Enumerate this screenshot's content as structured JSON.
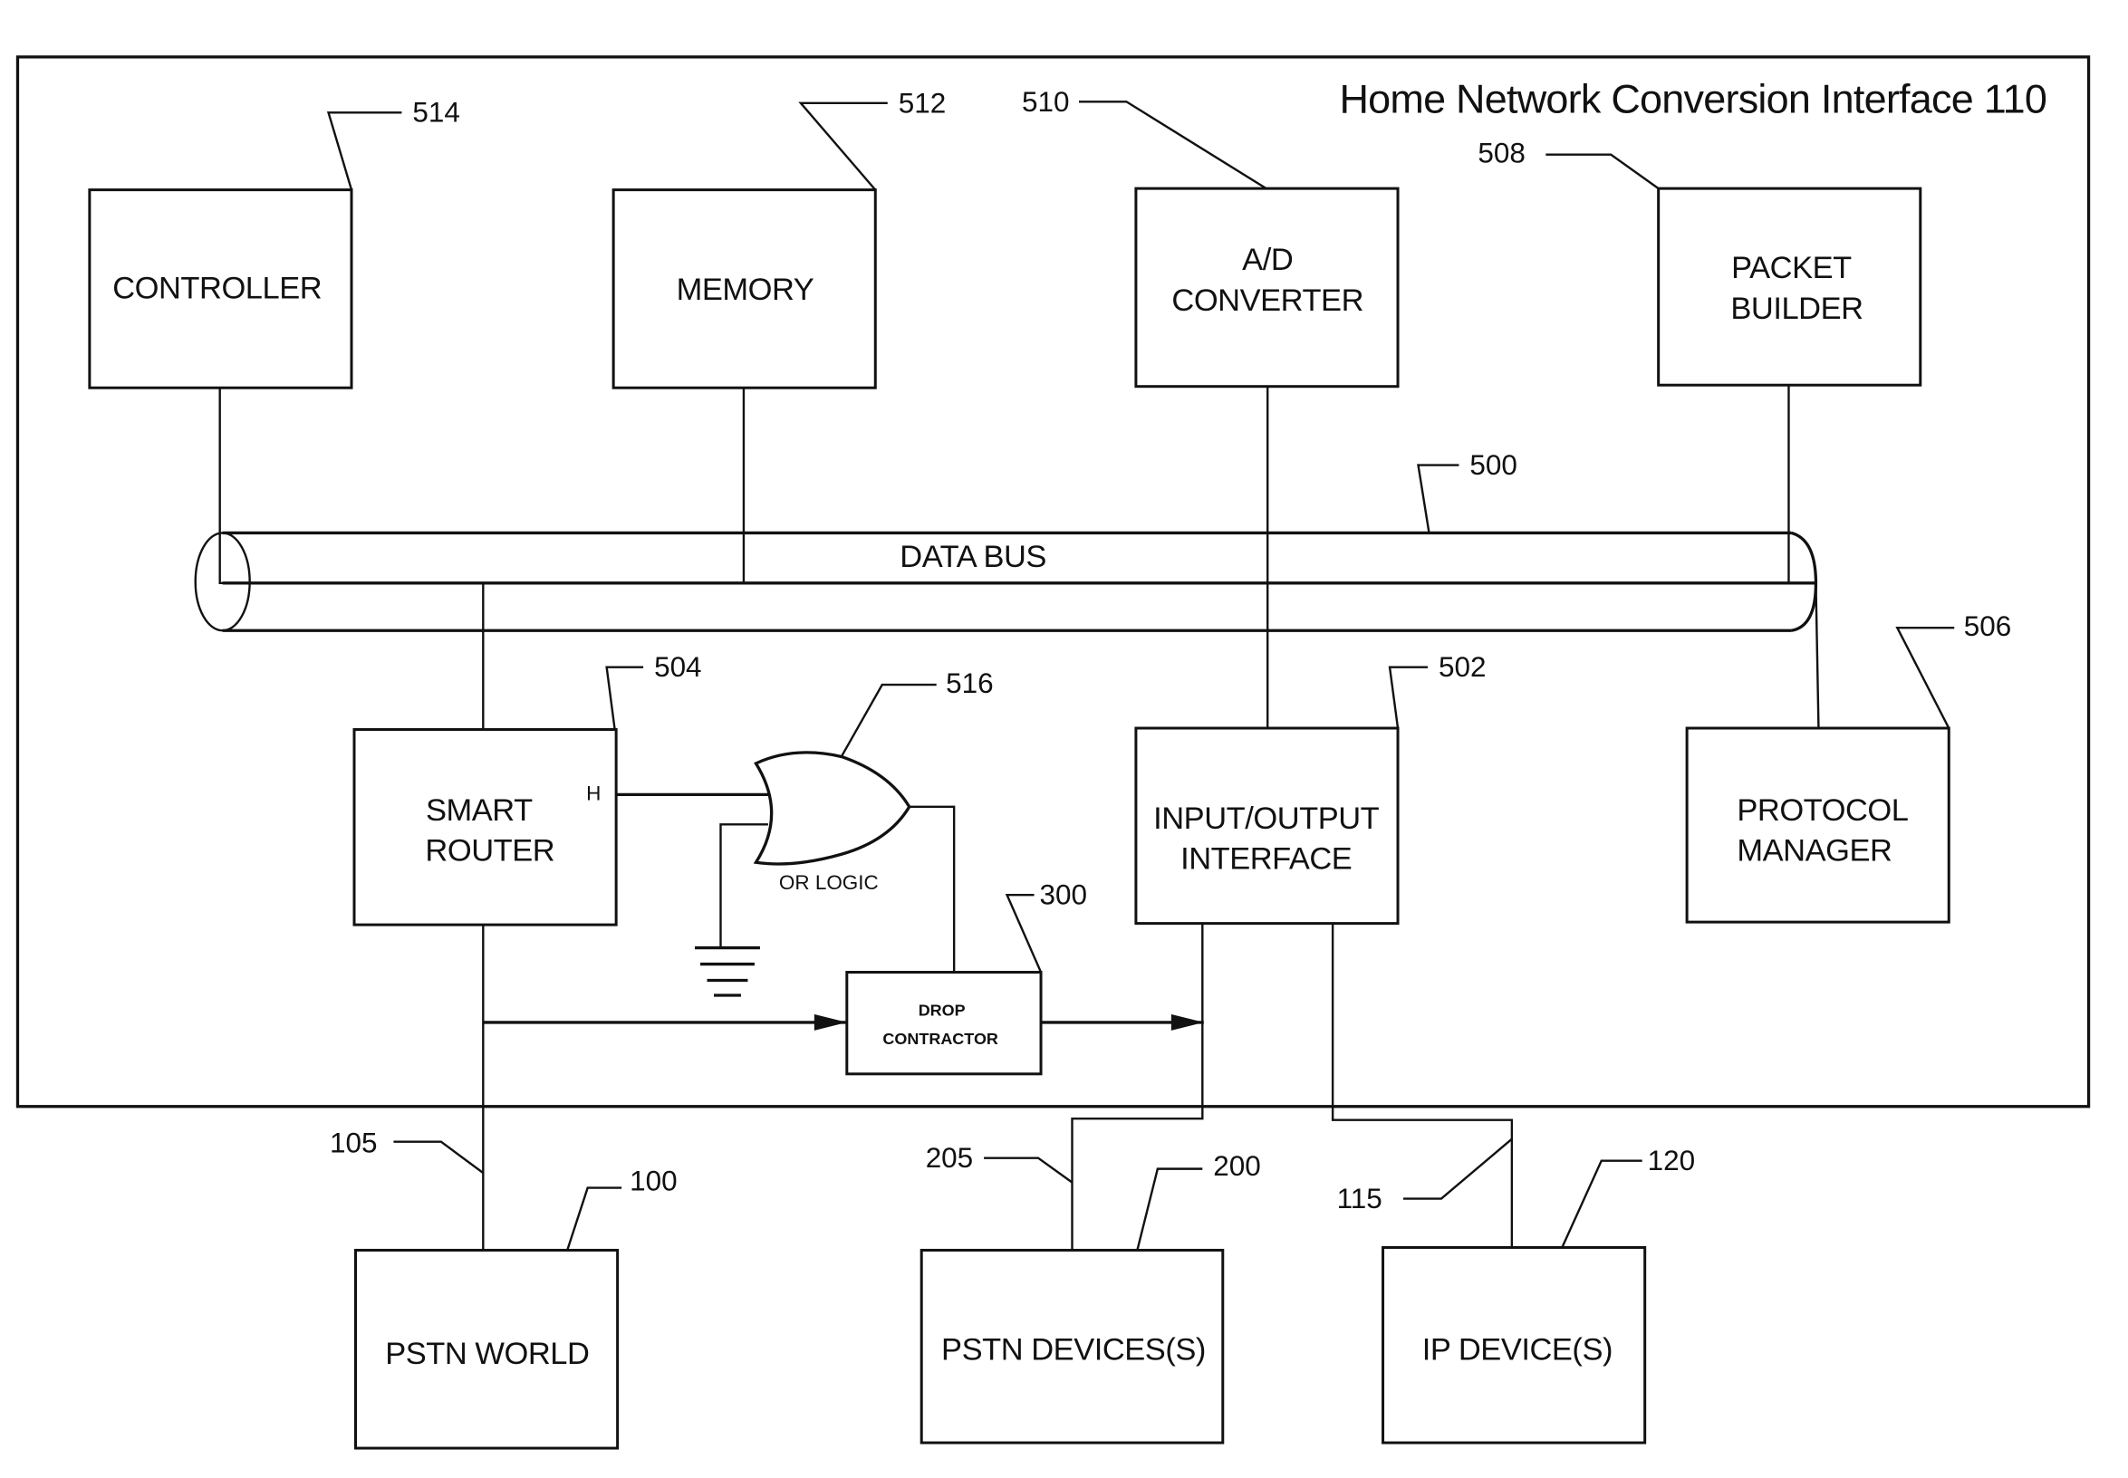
{
  "title": "Home Network Conversion Interface 110",
  "colors": {
    "ink": "#111111",
    "paper": "#ffffff"
  },
  "blocks": {
    "controller": {
      "lines": [
        "CONTROLLER"
      ],
      "ref": "514"
    },
    "memory": {
      "lines": [
        "MEMORY"
      ],
      "ref": "512"
    },
    "ad_converter": {
      "lines": [
        "A/D",
        "CONVERTER"
      ],
      "ref": "510"
    },
    "packet_builder": {
      "lines": [
        "PACKET",
        "BUILDER"
      ],
      "ref": "508"
    },
    "data_bus": {
      "lines": [
        "DATA BUS"
      ],
      "ref": "500"
    },
    "smart_router": {
      "lines": [
        "SMART",
        "ROUTER"
      ],
      "ref": "504",
      "pin_label": "H"
    },
    "or_logic": {
      "lines": [
        "OR LOGIC"
      ],
      "ref": "516"
    },
    "drop_contractor": {
      "lines": [
        "DROP",
        "CONTRACTOR"
      ],
      "ref": "300"
    },
    "io_interface": {
      "lines": [
        "INPUT/OUTPUT",
        "INTERFACE"
      ],
      "ref": "502"
    },
    "protocol_manager": {
      "lines": [
        "PROTOCOL",
        "MANAGER"
      ],
      "ref": "506"
    },
    "pstn_world": {
      "lines": [
        "PSTN WORLD"
      ],
      "ref": "100"
    },
    "pstn_devices": {
      "lines": [
        "PSTN DEVICES(S)"
      ],
      "ref": "200"
    },
    "ip_devices": {
      "lines": [
        "IP DEVICE(S)"
      ],
      "ref": "120"
    }
  },
  "links": {
    "pstn_line": {
      "ref": "105"
    },
    "pstn_device_line": {
      "ref": "205"
    },
    "ip_device_line": {
      "ref": "115"
    }
  },
  "icons": {
    "ground": "ground-symbol",
    "or_gate": "or-gate-symbol",
    "arrow": "arrowhead"
  }
}
